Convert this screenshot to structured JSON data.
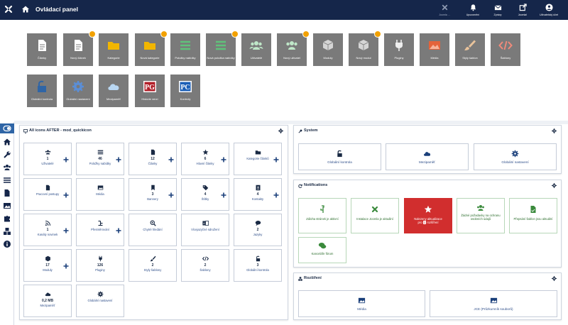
{
  "header": {
    "title": "Ovládací panel",
    "items": [
      {
        "label": "Joomla ...",
        "icon": "joomla-icon"
      },
      {
        "label": "Upozornění",
        "icon": "bell-icon"
      },
      {
        "label": "Zprávy",
        "icon": "envelope-icon"
      },
      {
        "label": "Joomla!",
        "icon": "external-link-icon"
      },
      {
        "label": "Uživatelský účet",
        "icon": "user-icon"
      }
    ]
  },
  "tiles": [
    {
      "label": "Články"
    },
    {
      "label": "Nový článek"
    },
    {
      "label": "Kategorie"
    },
    {
      "label": "Nová kategorie"
    },
    {
      "label": "Položky nabídky"
    },
    {
      "label": "Nová položka nabídky"
    },
    {
      "label": "Uživatelé"
    },
    {
      "label": "Nový uživatel"
    },
    {
      "label": "Moduly"
    },
    {
      "label": "Nový modul"
    },
    {
      "label": "Pluginy"
    },
    {
      "label": "Média"
    },
    {
      "label": "Styly šablon"
    },
    {
      "label": "Šablony"
    },
    {
      "label": "Globální kontrola"
    },
    {
      "label": "Globální nastavení"
    },
    {
      "label": "Mezipaměť"
    },
    {
      "label": "Historie verzí"
    },
    {
      "label": "Kontroly"
    }
  ],
  "all_icons": {
    "title": "All icons AFTER - mod_quickicon",
    "items": [
      {
        "num": "1",
        "label": "Uživatelé"
      },
      {
        "num": "46",
        "label": "Položky nabídky"
      },
      {
        "num": "12",
        "label": "Články"
      },
      {
        "num": "6",
        "label": "Hlavní články"
      },
      {
        "num": "",
        "label": "Kategorie článků"
      },
      {
        "num": "",
        "label": "Pracovní postupy"
      },
      {
        "num": "",
        "label": "Média"
      },
      {
        "num": "3",
        "label": "Bannery"
      },
      {
        "num": "4",
        "label": "Štítky"
      },
      {
        "num": "4",
        "label": "Kontakty"
      },
      {
        "num": "1",
        "label": "Kanály novinek"
      },
      {
        "num": "",
        "label": "Přesměrování"
      },
      {
        "num": "",
        "label": "Chytré hledání"
      },
      {
        "num": "",
        "label": "Vícejazyčné sdružení"
      },
      {
        "num": "2",
        "label": "Jazyky"
      },
      {
        "num": "17",
        "label": "Moduly"
      },
      {
        "num": "126",
        "label": "Pluginy"
      },
      {
        "num": "2",
        "label": "Styly šablony"
      },
      {
        "num": "2",
        "label": "Šablony"
      },
      {
        "num": "3",
        "label": "Globální kontrola"
      },
      {
        "num": "0,2 MB",
        "label": "Mezipaměť"
      },
      {
        "num": "",
        "label": "Globální nastavení"
      }
    ]
  },
  "system": {
    "title": "System",
    "items": [
      {
        "label": "Globální kontrola"
      },
      {
        "label": "Mezipaměť"
      },
      {
        "label": "Globální nastavení"
      }
    ]
  },
  "notifications": {
    "title": "Notifications",
    "items": [
      {
        "label": "Záloha stránek je aktivní"
      },
      {
        "label": "Instalace Joomla je aktuální"
      },
      {
        "label": "Nalezeny aktualizace",
        "label2a": "pro",
        "label2b": "1",
        "label2c": "rozšíření"
      },
      {
        "label": "Žádné požadavky na ochranu osobních údajů"
      },
      {
        "label": "Přepsání šablon jsou aktuální"
      },
      {
        "label": "Kanceláře fórum"
      }
    ]
  },
  "extensions": {
    "title": "Rozšíření",
    "items": [
      {
        "label": "Média"
      },
      {
        "label": "JCE (Průzkumník souborů)"
      }
    ]
  },
  "colors": {
    "header_bg": "#15264a",
    "tile_gray": "#7a7a7a",
    "accent_blue": "#2f65a6",
    "badge_orange": "#f2a100",
    "notification_red": "#d12e2e",
    "notification_green": "#3a8a3c"
  }
}
